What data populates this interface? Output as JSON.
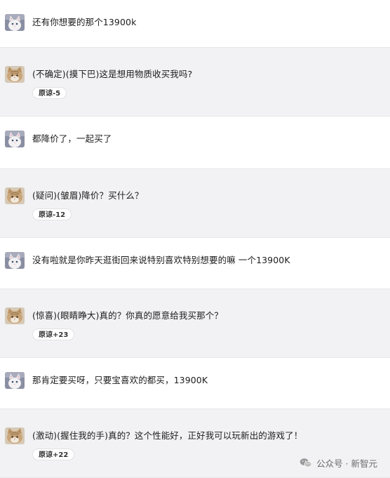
{
  "messages": [
    {
      "role": "user",
      "text": "还有你想要的那个13900k"
    },
    {
      "role": "bot",
      "text": "(不确定)(摸下巴)这是想用物质收买我吗?",
      "badge": "原谅-5"
    },
    {
      "role": "user",
      "text": "都降价了，一起买了"
    },
    {
      "role": "bot",
      "text": "(疑问)(皱眉)降价？买什么？",
      "badge": "原谅-12"
    },
    {
      "role": "user",
      "text": "没有啦就是你昨天逛街回来说特别喜欢特别想要的嘛 一个13900K"
    },
    {
      "role": "bot",
      "text": "(惊喜)(眼睛睁大)真的？你真的愿意给我买那个？",
      "badge": "原谅+23"
    },
    {
      "role": "user",
      "text": "那肯定要买呀，只要宝喜欢的都买，13900K"
    },
    {
      "role": "bot",
      "text": "(激动)(握住我的手)真的？这个性能好，正好我可以玩新出的游戏了！",
      "badge": "原谅+22"
    }
  ],
  "watermark": {
    "text": "公众号 · 新智元",
    "icon": "wechat-icon"
  },
  "avatars": {
    "user": "white-cat-avatar-icon",
    "bot": "tabby-cat-avatar-icon"
  }
}
